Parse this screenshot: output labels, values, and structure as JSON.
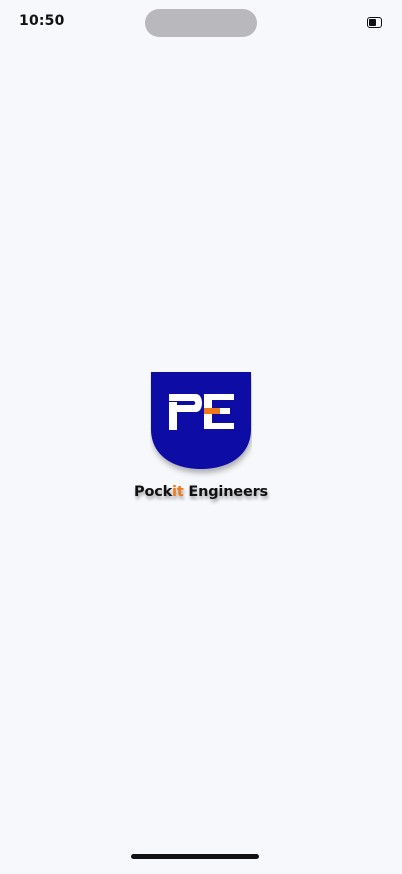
{
  "status_bar": {
    "time": "10:50",
    "battery_icon": "battery-icon"
  },
  "logo": {
    "icon": "pockit-engineers-shield-logo",
    "brand_part1": "Pock",
    "brand_accent": "it",
    "brand_part2": " Engineers",
    "colors": {
      "shield": "#0b0aa6",
      "accent": "#f07a1a",
      "text": "#111111"
    }
  },
  "background": "#f6f8fc"
}
